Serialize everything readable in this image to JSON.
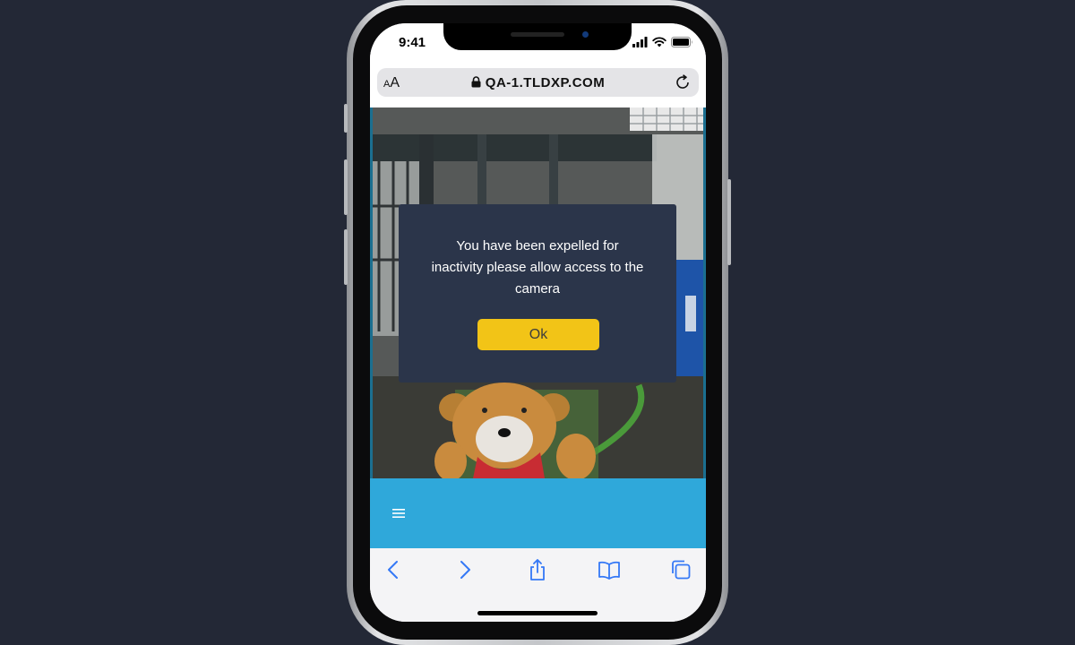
{
  "status_bar": {
    "time": "9:41"
  },
  "browser": {
    "text_size_label": "AA",
    "url": "QA-1.TLDXP.COM"
  },
  "dialog": {
    "message": "You have been expelled for inactivity please allow access to the camera",
    "ok_label": "Ok"
  },
  "colors": {
    "app_nav": "#2fa8da",
    "dialog_background": "#2b354a",
    "ok_button": "#f2c417",
    "toolbar_icons": "#3478f6",
    "page_background": "#232836"
  },
  "icons": {
    "status": [
      "signal-icon",
      "wifi-icon",
      "battery-icon"
    ],
    "browser": [
      "lock-icon",
      "reload-icon"
    ],
    "app": [
      "hamburger-menu-icon"
    ],
    "toolbar": [
      "back-icon",
      "forward-icon",
      "share-icon",
      "bookmarks-icon",
      "tabs-icon"
    ]
  }
}
